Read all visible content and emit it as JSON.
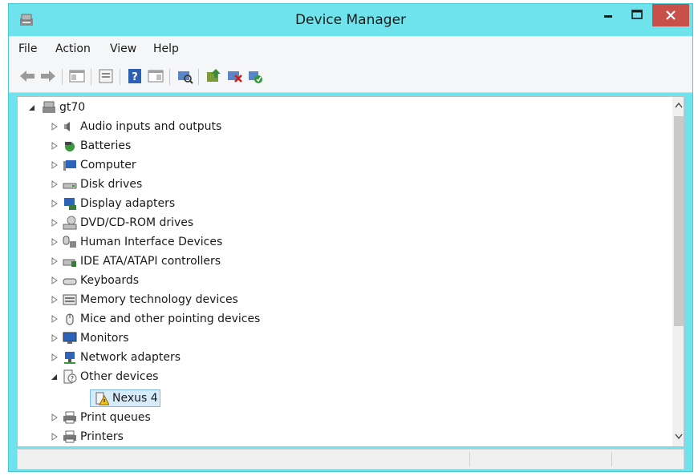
{
  "window": {
    "title": "Device Manager"
  },
  "menu": {
    "items": [
      "File",
      "Action",
      "View",
      "Help"
    ]
  },
  "toolbar": {
    "buttons": [
      "back-icon",
      "forward-icon",
      "show-hide-console-tree-icon",
      "properties-icon",
      "help-icon",
      "action-pane-icon",
      "scan-hardware-icon",
      "update-driver-icon",
      "disable-device-icon",
      "uninstall-device-icon"
    ]
  },
  "tree": {
    "root": "gt70",
    "categories": [
      "Audio inputs and outputs",
      "Batteries",
      "Computer",
      "Disk drives",
      "Display adapters",
      "DVD/CD-ROM drives",
      "Human Interface Devices",
      "IDE ATA/ATAPI controllers",
      "Keyboards",
      "Memory technology devices",
      "Mice and other pointing devices",
      "Monitors",
      "Network adapters",
      "Other devices",
      "Print queues",
      "Printers"
    ],
    "other_devices_child": "Nexus 4"
  },
  "colors": {
    "title_bar": "#6fe3ec",
    "close_button": "#c7504b",
    "selection": "#d7ecfb"
  }
}
